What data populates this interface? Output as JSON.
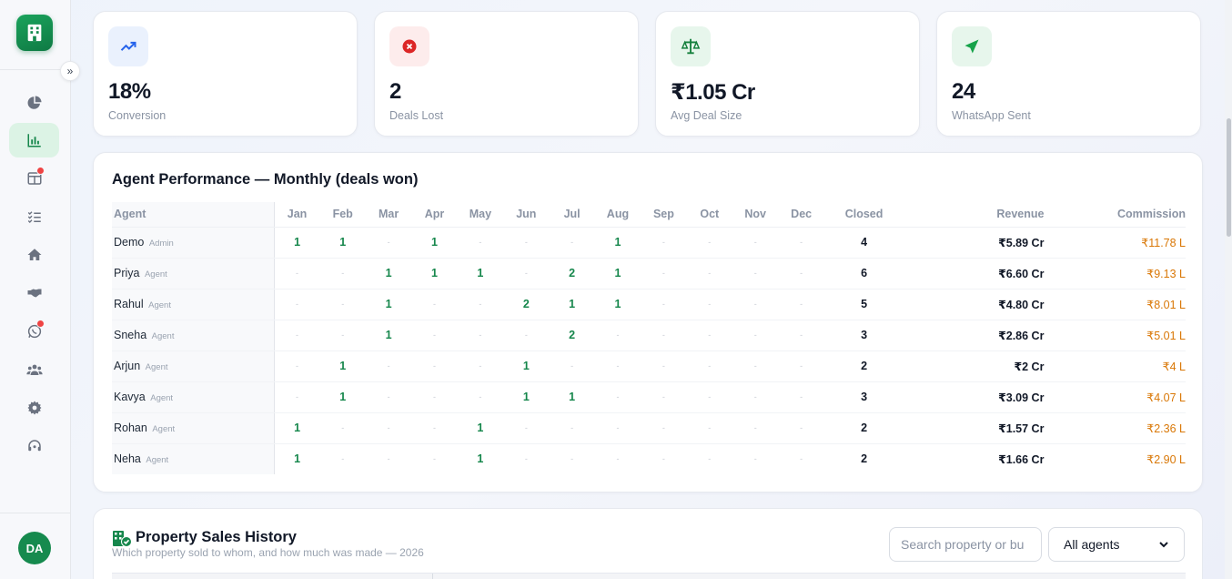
{
  "sidebar": {
    "avatar_initials": "DA",
    "items": [
      {
        "icon": "pie-chart-icon",
        "active": false,
        "badge": false
      },
      {
        "icon": "bar-chart-icon",
        "active": true,
        "badge": false
      },
      {
        "icon": "layout-columns-icon",
        "active": false,
        "badge": true
      },
      {
        "icon": "checklist-icon",
        "active": false,
        "badge": false
      },
      {
        "icon": "home-icon",
        "active": false,
        "badge": false
      },
      {
        "icon": "handshake-icon",
        "active": false,
        "badge": false
      },
      {
        "icon": "whatsapp-icon",
        "active": false,
        "badge": true
      },
      {
        "icon": "users-icon",
        "active": false,
        "badge": false
      },
      {
        "icon": "gear-icon",
        "active": false,
        "badge": false
      },
      {
        "icon": "headset-icon",
        "active": false,
        "badge": false
      }
    ]
  },
  "kpis": [
    {
      "value": "18%",
      "label": "Conversion",
      "icon": "trending-up-icon",
      "color": "#2563eb",
      "bg": "#eaf1fd"
    },
    {
      "value": "2",
      "label": "Deals Lost",
      "icon": "x-circle-icon",
      "color": "#dc2626",
      "bg": "#fdecec"
    },
    {
      "value": "₹1.05 Cr",
      "label": "Avg Deal Size",
      "icon": "scale-icon",
      "color": "#15803d",
      "bg": "#e7f6ec"
    },
    {
      "value": "24",
      "label": "WhatsApp Sent",
      "icon": "send-icon",
      "color": "#16a34a",
      "bg": "#e7f6ec"
    }
  ],
  "performance": {
    "title": "Agent Performance — Monthly (deals won)",
    "headers": {
      "agent": "Agent",
      "months": [
        "Jan",
        "Feb",
        "Mar",
        "Apr",
        "May",
        "Jun",
        "Jul",
        "Aug",
        "Sep",
        "Oct",
        "Nov",
        "Dec"
      ],
      "closed": "Closed",
      "revenue": "Revenue",
      "commission": "Commission"
    },
    "empty_marker": "-",
    "rows": [
      {
        "name": "Demo",
        "role": "Admin",
        "months": [
          1,
          1,
          0,
          1,
          0,
          0,
          0,
          1,
          0,
          0,
          0,
          0
        ],
        "closed": "4",
        "revenue": "₹5.89 Cr",
        "commission": "₹11.78 L"
      },
      {
        "name": "Priya",
        "role": "Agent",
        "months": [
          0,
          0,
          1,
          1,
          1,
          0,
          2,
          1,
          0,
          0,
          0,
          0
        ],
        "closed": "6",
        "revenue": "₹6.60 Cr",
        "commission": "₹9.13 L"
      },
      {
        "name": "Rahul",
        "role": "Agent",
        "months": [
          0,
          0,
          1,
          0,
          0,
          2,
          1,
          1,
          0,
          0,
          0,
          0
        ],
        "closed": "5",
        "revenue": "₹4.80 Cr",
        "commission": "₹8.01 L"
      },
      {
        "name": "Sneha",
        "role": "Agent",
        "months": [
          0,
          0,
          1,
          0,
          0,
          0,
          2,
          0,
          0,
          0,
          0,
          0
        ],
        "closed": "3",
        "revenue": "₹2.86 Cr",
        "commission": "₹5.01 L"
      },
      {
        "name": "Arjun",
        "role": "Agent",
        "months": [
          0,
          1,
          0,
          0,
          0,
          1,
          0,
          0,
          0,
          0,
          0,
          0
        ],
        "closed": "2",
        "revenue": "₹2 Cr",
        "commission": "₹4 L"
      },
      {
        "name": "Kavya",
        "role": "Agent",
        "months": [
          0,
          1,
          0,
          0,
          0,
          1,
          1,
          0,
          0,
          0,
          0,
          0
        ],
        "closed": "3",
        "revenue": "₹3.09 Cr",
        "commission": "₹4.07 L"
      },
      {
        "name": "Rohan",
        "role": "Agent",
        "months": [
          1,
          0,
          0,
          0,
          1,
          0,
          0,
          0,
          0,
          0,
          0,
          0
        ],
        "closed": "2",
        "revenue": "₹1.57 Cr",
        "commission": "₹2.36 L"
      },
      {
        "name": "Neha",
        "role": "Agent",
        "months": [
          1,
          0,
          0,
          0,
          1,
          0,
          0,
          0,
          0,
          0,
          0,
          0
        ],
        "closed": "2",
        "revenue": "₹1.66 Cr",
        "commission": "₹2.90 L"
      }
    ]
  },
  "sales": {
    "title": "Property Sales History",
    "subtitle": "Which property sold to whom, and how much was made — 2026",
    "search_placeholder": "Search property or bu",
    "agent_filter": "All agents"
  }
}
